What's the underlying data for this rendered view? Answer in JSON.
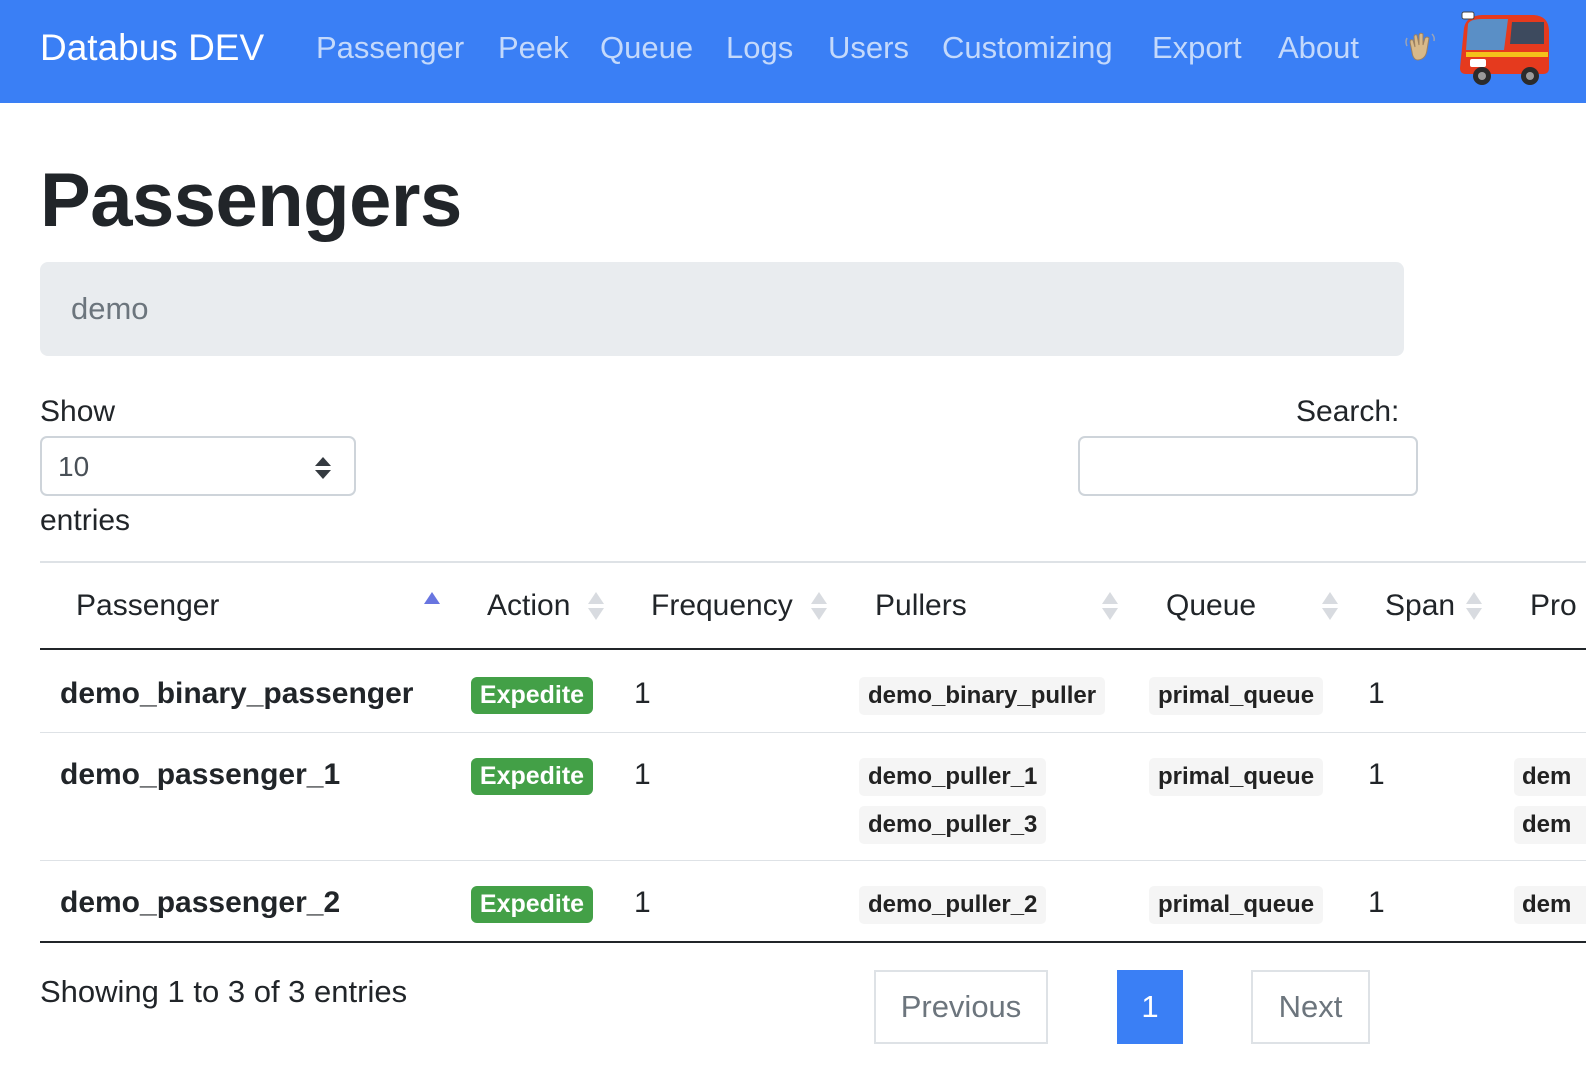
{
  "navbar": {
    "brand": "Databus DEV",
    "links": [
      "Passenger",
      "Peek",
      "Queue",
      "Logs",
      "Users",
      "Customizing",
      "Export",
      "About"
    ],
    "icons": [
      "waving-hand-icon",
      "bus-logo"
    ]
  },
  "page": {
    "title": "Passengers",
    "banner": "demo"
  },
  "table_controls": {
    "show_label": "Show",
    "page_length": "10",
    "entries_label": "entries",
    "search_label": "Search:",
    "search_value": ""
  },
  "table": {
    "columns": [
      "Passenger",
      "Action",
      "Frequency",
      "Pullers",
      "Queue",
      "Span",
      "Pro"
    ],
    "sort_column": "Passenger",
    "sort_direction": "ascending",
    "rows": [
      {
        "passenger": "demo_binary_passenger",
        "action": "Expedite",
        "frequency": "1",
        "pullers": [
          "demo_binary_puller"
        ],
        "queue": "primal_queue",
        "span": "1",
        "pro": []
      },
      {
        "passenger": "demo_passenger_1",
        "action": "Expedite",
        "frequency": "1",
        "pullers": [
          "demo_puller_1",
          "demo_puller_3"
        ],
        "queue": "primal_queue",
        "span": "1",
        "pro": [
          "dem",
          "dem"
        ]
      },
      {
        "passenger": "demo_passenger_2",
        "action": "Expedite",
        "frequency": "1",
        "pullers": [
          "demo_puller_2"
        ],
        "queue": "primal_queue",
        "span": "1",
        "pro": [
          "dem"
        ]
      }
    ]
  },
  "pagination": {
    "info": "Showing 1 to 3 of 3 entries",
    "previous": "Previous",
    "current_page": "1",
    "next": "Next"
  },
  "colors": {
    "navbar": "#3a7ff5",
    "badge_expedite": "#43a047",
    "banner": "#e9ecef",
    "sort_active": "#6875e0"
  }
}
